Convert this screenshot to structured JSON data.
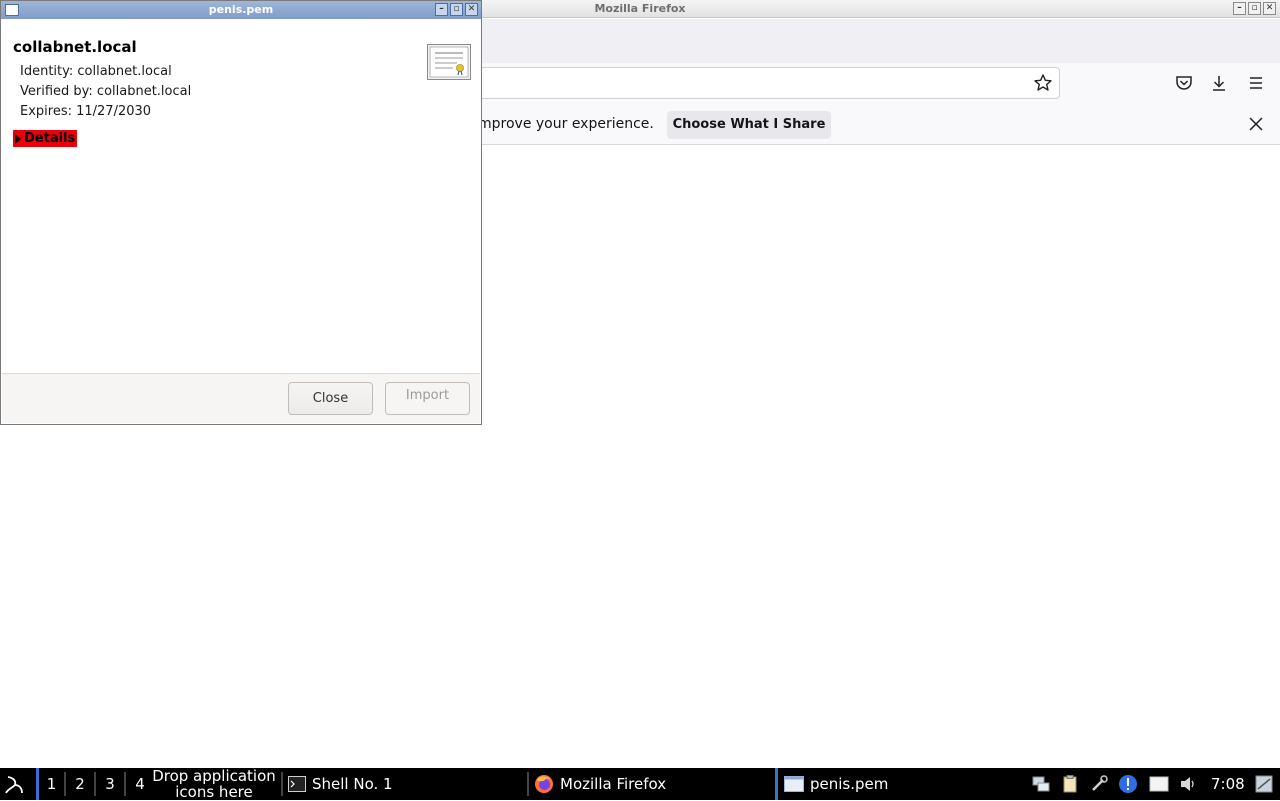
{
  "firefox": {
    "window_title": "Mozilla Firefox",
    "notification_text": "mprove your experience.",
    "choose_share_label": "Choose What I Share"
  },
  "dialog": {
    "title": "penis.pem",
    "cert_name": "collabnet.local",
    "identity": "Identity: collabnet.local",
    "verified_by": "Verified by: collabnet.local",
    "expires": "Expires: 11/27/2030",
    "details_label": "Details",
    "close_label": "Close",
    "import_label": "Import"
  },
  "taskbar": {
    "workspaces": [
      "1",
      "2",
      "3",
      "4"
    ],
    "drop_icons_label": "Drop application icons here",
    "tasks": {
      "shell": "Shell No. 1",
      "firefox": "Mozilla Firefox",
      "penis": "penis.pem"
    },
    "clock": "7:08"
  },
  "colors": {
    "details_highlight": "#e8000b",
    "dialog_titlebar": "#8fa9d2",
    "taskbar_active": "#3b6fd4"
  },
  "icons": [
    "star-icon",
    "pocket-icon",
    "download-icon",
    "menu-icon",
    "close-icon",
    "certificate-icon",
    "start-menu-icon",
    "terminal-icon",
    "firefox-icon",
    "window-icon",
    "network-icon",
    "clipboard-icon",
    "tools-icon",
    "alert-icon",
    "display-icon",
    "volume-icon",
    "tray-app-icon"
  ]
}
